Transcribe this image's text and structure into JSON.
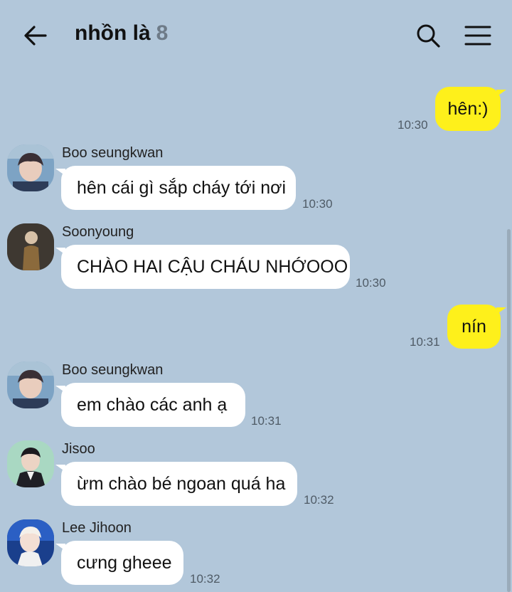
{
  "header": {
    "title": "nhồn là",
    "member_count": "8",
    "back_icon": "arrow-left-icon",
    "search_icon": "search-icon",
    "menu_icon": "hamburger-menu-icon"
  },
  "colors": {
    "background": "#b2c7da",
    "outgoing_bubble": "#fef01b",
    "incoming_bubble": "#ffffff"
  },
  "messages": [
    {
      "direction": "out",
      "text": "hên:)",
      "time": "10:30"
    },
    {
      "direction": "in",
      "sender": "Boo seungkwan",
      "text": "hên cái gì sắp cháy tới nơi",
      "time": "10:30"
    },
    {
      "direction": "in",
      "sender": "Soonyoung",
      "text": "CHÀO HAI CẬU CHÁU NHỚOOO",
      "time": "10:30"
    },
    {
      "direction": "out",
      "text": "nín",
      "time": "10:31"
    },
    {
      "direction": "in",
      "sender": "Boo seungkwan",
      "text": "em chào các anh ạ",
      "time": "10:31"
    },
    {
      "direction": "in",
      "sender": "Jisoo",
      "text": "ừm chào bé ngoan quá ha",
      "time": "10:32"
    },
    {
      "direction": "in",
      "sender": "Lee Jihoon",
      "text": "cưng gheee",
      "time": "10:32"
    }
  ]
}
